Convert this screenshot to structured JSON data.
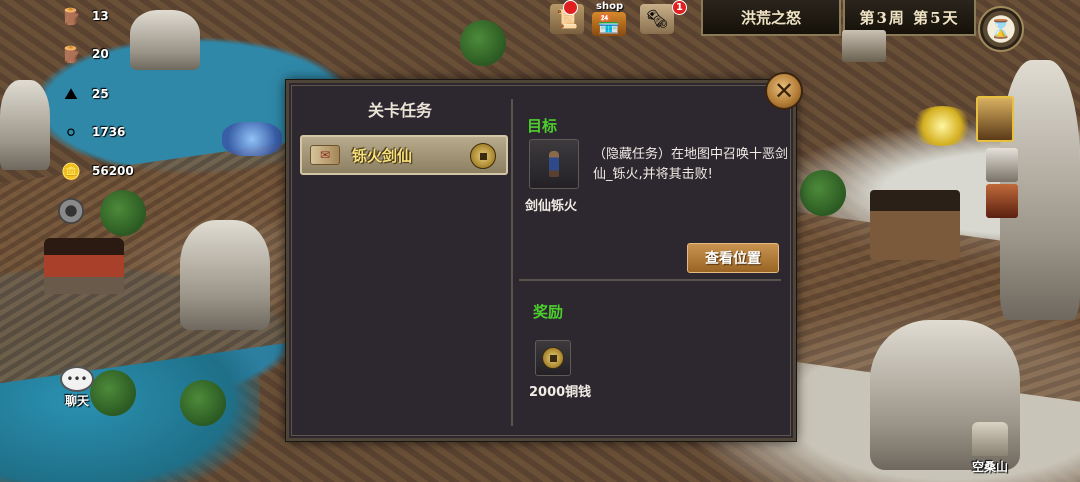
{
  "hud": {
    "resources": [
      {
        "icon": "wood-bundle-icon",
        "value": "13"
      },
      {
        "icon": "lumber-icon",
        "value": "20"
      },
      {
        "icon": "iron-ore-icon",
        "value": "25"
      },
      {
        "icon": "silver-icon",
        "value": "1736"
      },
      {
        "icon": "gold-ingot-icon",
        "value": "56200"
      }
    ],
    "shop_label": "shop",
    "scroll_badge": "1",
    "map_title": "洪荒之怒",
    "week_day": "第3周 第5天",
    "chat_label": "聊天",
    "location_label": "空桑山"
  },
  "dialog": {
    "panel_title": "关卡任务",
    "quest_name": "铄火剑仙",
    "target_heading": "目标",
    "target_description": "（隐藏任务）在地图中召唤十恶剑仙_铄火,并将其击败!",
    "target_name": "剑仙铄火",
    "view_location_button": "查看位置",
    "reward_heading": "奖励",
    "reward_text": "2000铜钱"
  },
  "colors": {
    "section_heading": "#4ccf2c",
    "quest_label": "#f6e27a",
    "dialog_bg": "#2d2830",
    "button": "#b07a34"
  }
}
